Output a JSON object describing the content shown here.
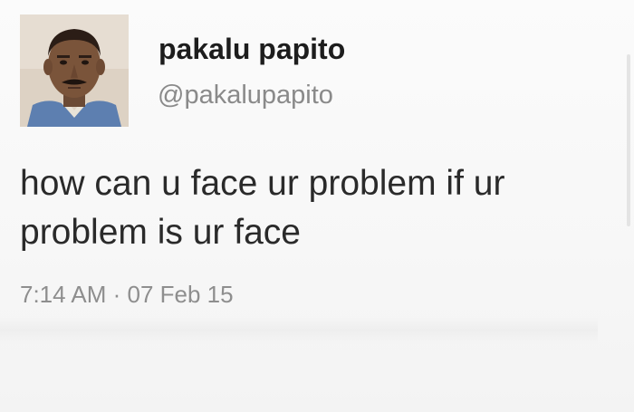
{
  "tweet": {
    "display_name": "pakalu papito",
    "handle": "@pakalupapito",
    "text_line_1": "how can u face ur problem if ur",
    "text_line_2": "problem is ur face",
    "timestamp": "7:14 AM · 07 Feb 15",
    "avatar_icon": "profile-photo"
  },
  "colors": {
    "name": "#1d1d1d",
    "handle": "#8a8a8a",
    "text": "#2a2a2a",
    "timestamp": "#8e8e8e",
    "background": "#f6f6f6"
  }
}
